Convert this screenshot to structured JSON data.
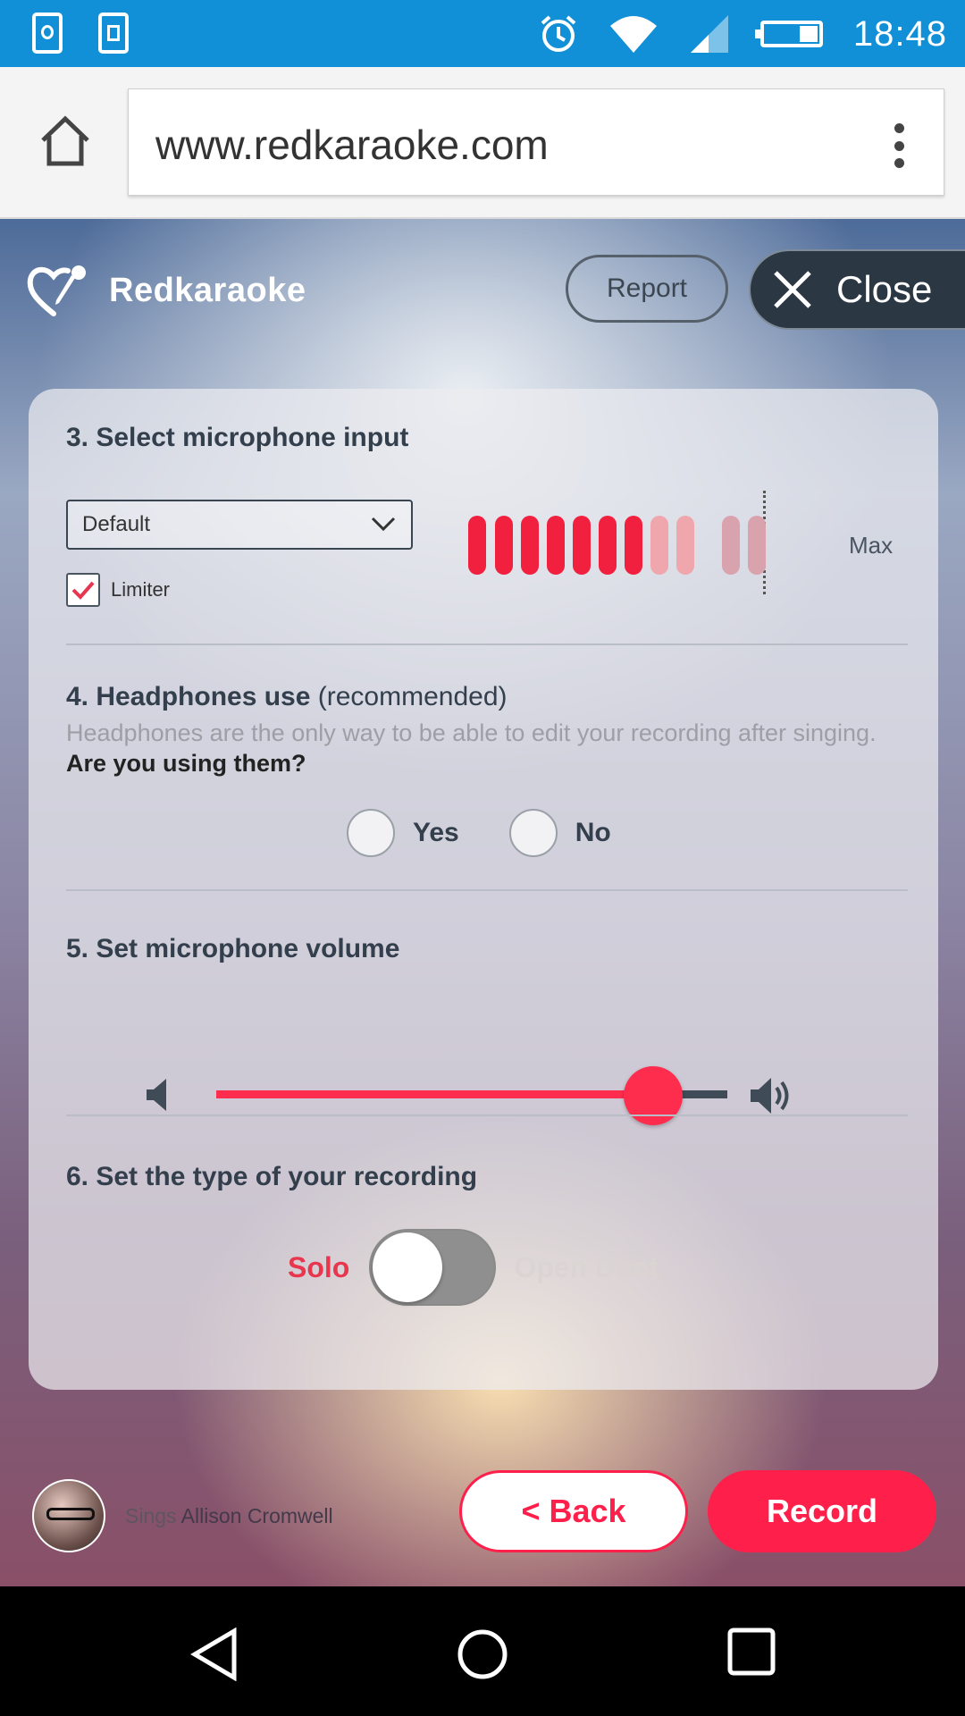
{
  "status_bar": {
    "time": "18:48"
  },
  "browser": {
    "url": "www.redkaraoke.com"
  },
  "header": {
    "logo_text": "Redkaraoke",
    "report_label": "Report",
    "close_label": "Close"
  },
  "sections": {
    "mic_input": {
      "title": "3. Select microphone input",
      "selected_device": "Default",
      "limiter_label": "Limiter",
      "limiter_checked": true,
      "meter_max_label": "Max",
      "meter_level_bars_active": 7,
      "meter_bars_total": 11
    },
    "headphones": {
      "title_bold": "4. Headphones use",
      "title_extra": " (recommended)",
      "description": "Headphones are the only way to be able to edit  your recording after singing.",
      "question": "Are you using them?",
      "yes_label": "Yes",
      "no_label": "No"
    },
    "volume": {
      "title": "5. Set microphone volume",
      "level_percent": 75
    },
    "recording_type": {
      "title": "6. Set the type of your recording",
      "solo_label": "Solo",
      "duet_label": "Open Duet",
      "selected": "Solo"
    }
  },
  "footer": {
    "sings_prefix": "Sings",
    "singer_name": "Allison Cromwell",
    "back_label": "< Back",
    "record_label": "Record"
  },
  "colors": {
    "accent": "#ff1f4b",
    "status_bar": "#1190d8",
    "dark": "#2c3744"
  }
}
